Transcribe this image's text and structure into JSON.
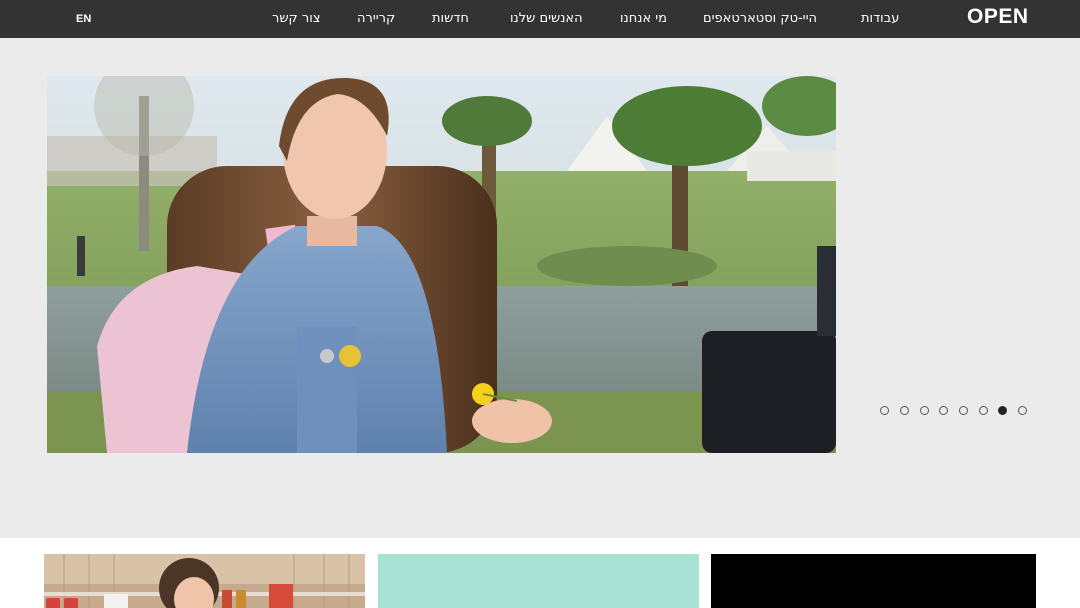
{
  "header": {
    "logo": "OPEN",
    "lang": "EN",
    "nav": [
      {
        "label": "עבודות"
      },
      {
        "label": "היי-טק וסטארטאפים"
      },
      {
        "label": "מי אנחנו"
      },
      {
        "label": "האנשים שלנו"
      },
      {
        "label": "חדשות"
      },
      {
        "label": "קריירה"
      },
      {
        "label": "צור קשר"
      }
    ]
  },
  "carousel": {
    "slide_count": 8,
    "active_index": 6,
    "image": "photo-girl-with-backpack-holding-flower-in-park"
  },
  "cards": [
    {
      "image": "photo-girl-in-kitchen"
    },
    {
      "color": "#a8e2d5"
    },
    {
      "color": "#000000"
    }
  ],
  "colors": {
    "topbar": "#333333",
    "hero_bg": "#ebebeb",
    "dot_active": "#222222"
  }
}
